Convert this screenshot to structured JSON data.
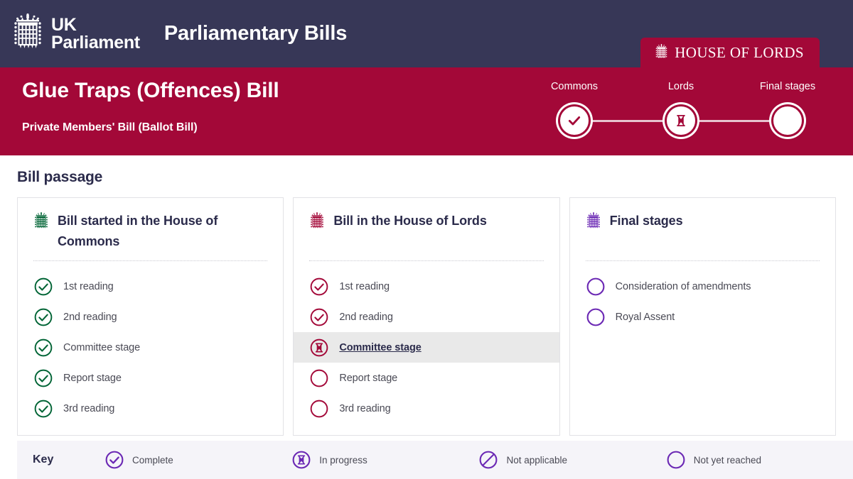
{
  "header": {
    "brand_line1": "UK",
    "brand_line2": "Parliament",
    "logo_icon": "portcullis-icon",
    "app_title": "Parliamentary Bills",
    "house_badge": {
      "label": "HOUSE OF LORDS",
      "icon": "portcullis-icon",
      "color": "#A30838"
    },
    "background_color": "#373757"
  },
  "bill": {
    "title": "Glue Traps (Offences) Bill",
    "subtitle": "Private Members' Bill (Ballot Bill)",
    "background_color": "#A30838"
  },
  "tracker": {
    "nodes": [
      {
        "label": "Commons",
        "icon": "check-icon",
        "state": "complete"
      },
      {
        "label": "Lords",
        "icon": "hourglass-icon",
        "state": "in-progress"
      },
      {
        "label": "Final stages",
        "icon": "blank-icon",
        "state": "not-yet-reached"
      }
    ]
  },
  "main": {
    "section_title": "Bill passage",
    "cards": [
      {
        "title": "Bill started in the House of Commons",
        "icon": "portcullis-icon",
        "accent": "#006435",
        "stages": [
          {
            "label": "1st reading",
            "icon": "check-icon",
            "state": "complete"
          },
          {
            "label": "2nd reading",
            "icon": "check-icon",
            "state": "complete"
          },
          {
            "label": "Committee stage",
            "icon": "check-icon",
            "state": "complete"
          },
          {
            "label": "Report stage",
            "icon": "check-icon",
            "state": "complete"
          },
          {
            "label": "3rd reading",
            "icon": "check-icon",
            "state": "complete"
          }
        ]
      },
      {
        "title": "Bill in the House of Lords",
        "icon": "portcullis-icon",
        "accent": "#A30838",
        "stages": [
          {
            "label": "1st reading",
            "icon": "check-icon",
            "state": "complete"
          },
          {
            "label": "2nd reading",
            "icon": "check-icon",
            "state": "complete"
          },
          {
            "label": "Committee stage",
            "icon": "hourglass-icon",
            "state": "current"
          },
          {
            "label": "Report stage",
            "icon": "blank-icon",
            "state": "not-yet-reached"
          },
          {
            "label": "3rd reading",
            "icon": "blank-icon",
            "state": "not-yet-reached"
          }
        ]
      },
      {
        "title": "Final stages",
        "icon": "portcullis-icon",
        "accent": "#6B28B4",
        "stages": [
          {
            "label": "Consideration of amendments",
            "icon": "blank-icon",
            "state": "not-yet-reached"
          },
          {
            "label": "Royal Assent",
            "icon": "blank-icon",
            "state": "not-yet-reached"
          }
        ]
      }
    ]
  },
  "key": {
    "title": "Key",
    "accent": "#6B28B4",
    "items": [
      {
        "label": "Complete",
        "icon": "check-icon"
      },
      {
        "label": "In progress",
        "icon": "hourglass-icon"
      },
      {
        "label": "Not applicable",
        "icon": "no-entry-icon"
      },
      {
        "label": "Not yet reached",
        "icon": "blank-icon"
      }
    ]
  }
}
